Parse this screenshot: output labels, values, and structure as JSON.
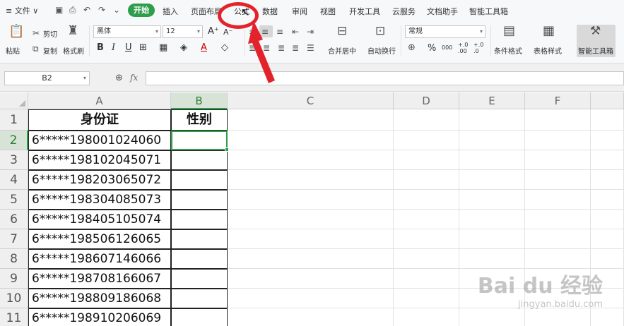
{
  "window": {
    "file_menu": "≡ 文件 ∨",
    "quick_access": [
      "save",
      "print",
      "undo",
      "redo",
      "more"
    ],
    "tabs": [
      "开始",
      "插入",
      "页面布局",
      "公式",
      "数据",
      "审阅",
      "视图",
      "开发工具",
      "云服务",
      "文档助手",
      "智能工具箱"
    ],
    "active_tab": "开始"
  },
  "ribbon": {
    "paste": "粘贴",
    "cut": "剪切",
    "copy": "复制",
    "format_painter": "格式刷",
    "font_name": "黑体",
    "font_size": "12",
    "merge_center": "合并居中",
    "wrap_text": "自动换行",
    "number_format": "常规",
    "conditional_format": "条件格式",
    "table_style": "表格样式",
    "smart_toolbox": "智能工具箱",
    "bold": "B",
    "italic": "I",
    "underline": "U",
    "font_color_letter": "A",
    "increase_font": "A⁺",
    "decrease_font": "A⁻",
    "percent": "%",
    "thousands": "000",
    "inc_decimal": "+.0 .00",
    "dec_decimal": "+.0 .0"
  },
  "formula_bar": {
    "name_box": "B2",
    "fx": "fx",
    "formula": ""
  },
  "sheet": {
    "columns": [
      "A",
      "B",
      "C",
      "D",
      "E",
      "F"
    ],
    "rows": [
      "1",
      "2",
      "3",
      "4",
      "5",
      "6",
      "7",
      "8",
      "9",
      "10",
      "11"
    ],
    "header_row": [
      "身份证",
      "性别"
    ],
    "ids": [
      "6*****198001024060",
      "6*****198102045071",
      "6*****198203065072",
      "6*****198304085073",
      "6*****198405105074",
      "6*****198506126065",
      "6*****198607146066",
      "6*****198708166067",
      "6*****198809186068",
      "6*****198910206069"
    ],
    "selected_cell": "B2"
  },
  "watermark": {
    "brand": "Bai du 经验",
    "url": "jingyan.baidu.com"
  },
  "colors": {
    "accent": "#2e9e4b",
    "annotation": "#e2232b"
  }
}
